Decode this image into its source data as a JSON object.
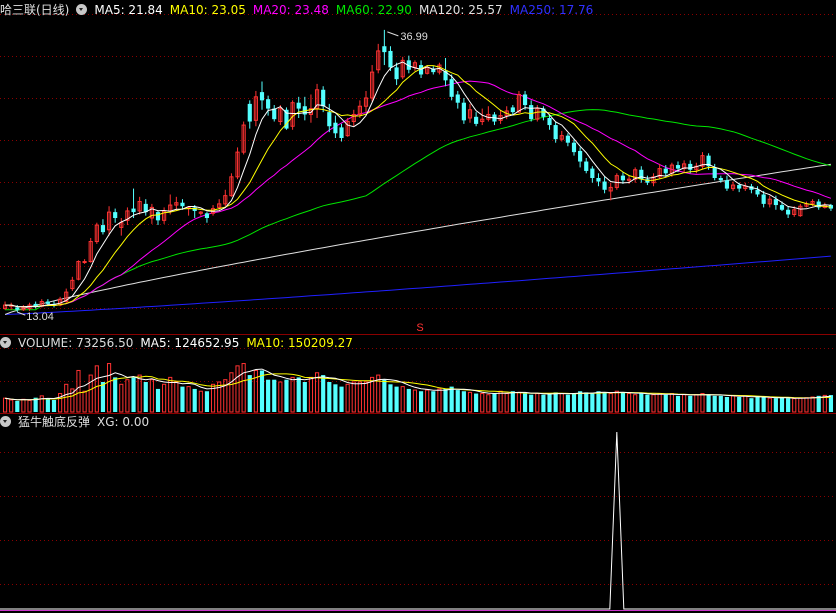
{
  "colors": {
    "bg": "#000000",
    "grid": "#8a0000",
    "up": "#ff3232",
    "down": "#54ffff",
    "ma5": "#ffffff",
    "ma10": "#ffff00",
    "ma20": "#ff00ff",
    "ma60": "#00e600",
    "ma120": "#e0e0e0",
    "ma250": "#2020ff",
    "vol_ma5": "#ffffff",
    "vol_ma10": "#ffff00"
  },
  "price_panel": {
    "title": "哈三联(日线)",
    "ma": [
      {
        "label": "MA5: 21.84",
        "color": "#ffffff"
      },
      {
        "label": "MA10: 23.05",
        "color": "#ffff00"
      },
      {
        "label": "MA20: 23.48",
        "color": "#ff00ff"
      },
      {
        "label": "MA60: 22.90",
        "color": "#00e600"
      },
      {
        "label": "MA120: 25.57",
        "color": "#e0e0e0"
      },
      {
        "label": "MA250: 17.76",
        "color": "#2020ff"
      }
    ],
    "high_label": "36.99",
    "low_label": "13.04",
    "marker_label": "S"
  },
  "volume_panel": {
    "items": [
      {
        "label": "VOLUME: 73256.50",
        "color": "#dddddd"
      },
      {
        "label": "MA5: 124652.95",
        "color": "#ffffff"
      },
      {
        "label": "MA10: 150209.27",
        "color": "#ffff00"
      }
    ]
  },
  "indicator_panel": {
    "items": [
      {
        "label": "猛牛触底反弹",
        "color": "#dddddd"
      },
      {
        "label": "XG: 0.00",
        "color": "#dddddd"
      }
    ]
  },
  "chart_data": [
    {
      "type": "candlestick",
      "title": "哈三联(日线)",
      "y_range": [
        12.5,
        38.0
      ],
      "max_label": 36.99,
      "min_label": 13.04,
      "candles": [
        [
          13.3,
          13.6,
          13.2,
          13.9
        ],
        [
          13.5,
          13.6,
          13.2,
          13.8
        ],
        [
          13.4,
          13.2,
          13.0,
          13.6
        ],
        [
          13.2,
          13.4,
          13.1,
          13.6
        ],
        [
          13.3,
          13.6,
          13.1,
          13.8
        ],
        [
          13.7,
          13.5,
          13.3,
          13.9
        ],
        [
          13.5,
          13.9,
          13.4,
          14.1
        ],
        [
          13.9,
          13.7,
          13.5,
          14.1
        ],
        [
          13.7,
          13.6,
          13.4,
          13.9
        ],
        [
          13.6,
          14.1,
          13.5,
          14.3
        ],
        [
          13.9,
          14.7,
          13.8,
          15.0
        ],
        [
          15.0,
          15.7,
          14.8,
          16.0
        ],
        [
          15.8,
          17.3,
          15.7,
          17.4
        ],
        [
          17.3,
          17.3,
          17.1,
          17.5
        ],
        [
          17.3,
          19.0,
          17.2,
          19.3
        ],
        [
          19.0,
          20.4,
          18.8,
          20.6
        ],
        [
          20.4,
          19.8,
          19.6,
          20.9
        ],
        [
          20.0,
          21.5,
          19.5,
          22.0
        ],
        [
          21.5,
          21.0,
          20.6,
          21.8
        ],
        [
          20.2,
          20.6,
          19.5,
          21.0
        ],
        [
          20.8,
          21.6,
          20.4,
          21.9
        ],
        [
          21.8,
          21.5,
          21.0,
          23.5
        ],
        [
          21.6,
          22.4,
          21.3,
          22.8
        ],
        [
          22.2,
          21.5,
          21.2,
          22.6
        ],
        [
          21.0,
          21.9,
          20.5,
          22.2
        ],
        [
          21.5,
          20.8,
          20.4,
          21.6
        ],
        [
          20.8,
          21.6,
          20.5,
          21.9
        ],
        [
          21.6,
          22.1,
          21.3,
          23.0
        ],
        [
          22.1,
          22.3,
          21.6,
          22.8
        ],
        [
          22.3,
          22.0,
          21.7,
          22.6
        ],
        [
          21.8,
          21.9,
          21.2,
          22.0
        ],
        [
          21.9,
          21.6,
          21.0,
          22.1
        ],
        [
          21.4,
          21.5,
          21.2,
          21.6
        ],
        [
          21.4,
          21.0,
          20.6,
          21.5
        ],
        [
          21.4,
          21.8,
          21.2,
          22.1
        ],
        [
          21.9,
          22.2,
          21.7,
          22.6
        ],
        [
          22.2,
          22.9,
          22.0,
          23.4
        ],
        [
          22.9,
          24.5,
          22.8,
          24.8
        ],
        [
          24.5,
          26.6,
          24.3,
          27.0
        ],
        [
          26.6,
          28.9,
          26.4,
          29.2
        ],
        [
          30.7,
          29.2,
          28.6,
          31.0
        ],
        [
          29.3,
          31.3,
          28.8,
          31.8
        ],
        [
          31.7,
          31.0,
          30.2,
          32.6
        ],
        [
          31.1,
          30.3,
          29.7,
          31.4
        ],
        [
          30.3,
          29.4,
          29.2,
          30.6
        ],
        [
          29.2,
          30.3,
          28.9,
          30.6
        ],
        [
          30.2,
          28.6,
          28.5,
          30.4
        ],
        [
          28.8,
          30.8,
          28.5,
          31.0
        ],
        [
          30.8,
          30.3,
          29.5,
          31.3
        ],
        [
          30.5,
          29.8,
          29.3,
          31.3
        ],
        [
          29.8,
          30.3,
          29.1,
          31.5
        ],
        [
          30.3,
          31.9,
          29.5,
          32.4
        ],
        [
          31.9,
          30.5,
          30.0,
          32.2
        ],
        [
          30.0,
          28.8,
          28.3,
          30.7
        ],
        [
          29.1,
          28.2,
          27.8,
          29.7
        ],
        [
          28.7,
          27.8,
          27.5,
          29.0
        ],
        [
          28.0,
          29.2,
          27.9,
          29.5
        ],
        [
          29.2,
          29.8,
          28.8,
          30.2
        ],
        [
          29.8,
          30.5,
          29.5,
          31.0
        ],
        [
          30.5,
          31.2,
          30.0,
          31.8
        ],
        [
          31.2,
          33.4,
          30.9,
          34.0
        ],
        [
          33.6,
          35.2,
          33.3,
          35.8
        ],
        [
          35.6,
          35.1,
          34.0,
          36.99
        ],
        [
          35.2,
          33.8,
          33.5,
          35.6
        ],
        [
          33.8,
          32.8,
          32.3,
          34.2
        ],
        [
          33.0,
          34.4,
          32.8,
          34.7
        ],
        [
          34.4,
          33.6,
          33.3,
          34.8
        ],
        [
          33.8,
          34.2,
          33.5,
          34.4
        ],
        [
          34.0,
          33.2,
          32.9,
          34.4
        ],
        [
          33.3,
          33.8,
          33.2,
          34.0
        ],
        [
          33.7,
          33.4,
          33.2,
          33.9
        ],
        [
          33.4,
          34.0,
          33.2,
          34.2
        ],
        [
          33.5,
          32.7,
          32.2,
          34.6
        ],
        [
          32.8,
          31.3,
          31.0,
          33.2
        ],
        [
          31.5,
          30.8,
          30.3,
          31.8
        ],
        [
          30.8,
          29.3,
          29.0,
          31.2
        ],
        [
          29.5,
          30.2,
          29.1,
          30.7
        ],
        [
          29.6,
          29.0,
          28.8,
          30.0
        ],
        [
          29.2,
          29.4,
          28.9,
          30.3
        ],
        [
          29.4,
          29.8,
          29.2,
          30.5
        ],
        [
          29.8,
          29.2,
          28.9,
          30.0
        ],
        [
          29.3,
          29.7,
          29.0,
          30.2
        ],
        [
          29.7,
          30.1,
          29.4,
          30.5
        ],
        [
          30.4,
          30.0,
          29.8,
          30.6
        ],
        [
          30.0,
          31.5,
          29.9,
          31.8
        ],
        [
          31.5,
          30.6,
          30.2,
          31.8
        ],
        [
          30.6,
          29.4,
          29.2,
          31.0
        ],
        [
          29.4,
          30.3,
          29.2,
          30.6
        ],
        [
          30.3,
          29.6,
          29.3,
          30.5
        ],
        [
          29.5,
          28.9,
          28.5,
          29.8
        ],
        [
          28.9,
          27.7,
          27.4,
          29.2
        ],
        [
          27.7,
          28.0,
          27.5,
          28.4
        ],
        [
          28.0,
          27.4,
          27.1,
          28.2
        ],
        [
          27.4,
          26.6,
          26.3,
          27.7
        ],
        [
          26.7,
          25.8,
          25.3,
          27.0
        ],
        [
          25.8,
          25.0,
          24.8,
          26.1
        ],
        [
          25.2,
          24.4,
          24.0,
          25.4
        ],
        [
          24.4,
          24.1,
          23.7,
          24.8
        ],
        [
          24.1,
          23.4,
          23.1,
          24.5
        ],
        [
          23.3,
          23.6,
          22.5,
          24.0
        ],
        [
          23.6,
          24.6,
          23.4,
          24.8
        ],
        [
          24.6,
          24.2,
          23.9,
          24.9
        ],
        [
          24.2,
          24.3,
          23.9,
          24.6
        ],
        [
          24.3,
          25.1,
          24.0,
          25.3
        ],
        [
          25.1,
          24.3,
          24.0,
          25.4
        ],
        [
          24.3,
          24.0,
          23.8,
          24.6
        ],
        [
          24.0,
          24.5,
          23.7,
          24.8
        ],
        [
          24.5,
          25.2,
          24.3,
          25.6
        ],
        [
          25.2,
          24.8,
          24.5,
          25.5
        ],
        [
          24.8,
          25.5,
          24.5,
          25.7
        ],
        [
          25.5,
          25.2,
          24.9,
          25.8
        ],
        [
          25.2,
          25.6,
          24.9,
          25.9
        ],
        [
          25.6,
          25.1,
          24.8,
          25.9
        ],
        [
          25.1,
          25.4,
          24.8,
          25.7
        ],
        [
          25.4,
          26.3,
          25.2,
          26.6
        ],
        [
          26.3,
          25.4,
          25.1,
          26.5
        ],
        [
          25.3,
          24.4,
          24.2,
          25.6
        ],
        [
          24.4,
          24.2,
          24.0,
          24.6
        ],
        [
          24.2,
          23.5,
          23.3,
          24.6
        ],
        [
          23.5,
          23.8,
          23.3,
          24.1
        ],
        [
          23.8,
          23.5,
          23.2,
          24.0
        ],
        [
          23.5,
          23.7,
          23.3,
          24.0
        ],
        [
          23.7,
          23.4,
          23.1,
          23.9
        ],
        [
          23.4,
          23.0,
          22.8,
          23.7
        ],
        [
          23.0,
          22.2,
          21.9,
          23.3
        ],
        [
          22.2,
          22.6,
          21.9,
          22.9
        ],
        [
          22.6,
          22.1,
          21.7,
          22.9
        ],
        [
          22.1,
          21.7,
          21.6,
          22.4
        ],
        [
          21.7,
          21.3,
          21.0,
          22.0
        ],
        [
          21.3,
          21.7,
          21.1,
          22.0
        ],
        [
          21.2,
          22.0,
          21.1,
          22.2
        ],
        [
          22.0,
          22.2,
          21.9,
          22.4
        ],
        [
          22.2,
          22.4,
          22.0,
          22.6
        ],
        [
          22.4,
          21.9,
          21.7,
          22.6
        ],
        [
          21.9,
          22.1,
          21.8,
          22.3
        ],
        [
          22.1,
          21.8,
          21.6,
          22.2
        ]
      ],
      "series": [
        {
          "name": "MA5",
          "last": 21.84
        },
        {
          "name": "MA10",
          "last": 23.05
        },
        {
          "name": "MA20",
          "last": 23.48
        },
        {
          "name": "MA60",
          "last": 22.9
        },
        {
          "name": "MA120",
          "last": 25.57
        },
        {
          "name": "MA250",
          "last": 17.76
        }
      ]
    },
    {
      "type": "bar",
      "title": "VOLUME",
      "y_range": [
        0,
        260000
      ],
      "last_value": 73256.5,
      "ma5_last": 124652.95,
      "ma10_last": 150209.27,
      "values": [
        60000,
        52000,
        48000,
        55000,
        50000,
        62000,
        70000,
        58000,
        52000,
        80000,
        120000,
        100000,
        180000,
        90000,
        160000,
        200000,
        130000,
        210000,
        150000,
        120000,
        140000,
        150000,
        160000,
        130000,
        140000,
        100000,
        120000,
        150000,
        130000,
        110000,
        110000,
        100000,
        90000,
        90000,
        120000,
        130000,
        140000,
        170000,
        200000,
        210000,
        160000,
        180000,
        180000,
        140000,
        140000,
        130000,
        140000,
        150000,
        150000,
        130000,
        150000,
        170000,
        160000,
        130000,
        120000,
        110000,
        120000,
        130000,
        130000,
        130000,
        150000,
        160000,
        140000,
        120000,
        110000,
        110000,
        100000,
        95000,
        90000,
        95000,
        90000,
        100000,
        100000,
        110000,
        95000,
        90000,
        85000,
        80000,
        80000,
        75000,
        80000,
        90000,
        80000,
        90000,
        85000,
        80000,
        75000,
        80000,
        75000,
        80000,
        85000,
        80000,
        75000,
        80000,
        90000,
        85000,
        80000,
        90000,
        85000,
        80000,
        90000,
        85000,
        80000,
        75000,
        80000,
        75000,
        75000,
        80000,
        75000,
        80000,
        70000,
        75000,
        70000,
        75000,
        80000,
        75000,
        70000,
        70000,
        65000,
        70000,
        65000,
        70000,
        60000,
        65000,
        65000,
        60000,
        60000,
        62000,
        60000,
        58000,
        60000,
        62000,
        65000,
        70000,
        72000,
        73256.5
      ]
    },
    {
      "type": "line",
      "title": "猛牛触底反弹",
      "series": [
        {
          "name": "XG",
          "last": 0.0
        }
      ],
      "y_range": [
        0,
        1
      ],
      "signal_index": 100
    }
  ]
}
